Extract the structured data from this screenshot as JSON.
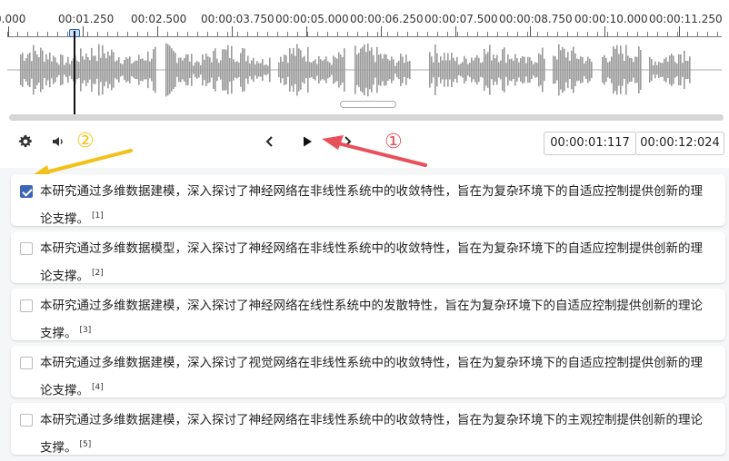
{
  "timeline": {
    "ticks": [
      "0.000",
      "00:01.250",
      "00:02.500",
      "00:00:03.750",
      "00:00:05.000",
      "00:00:06.250",
      "00:00:07.500",
      "00:00:08.750",
      "00:00:10.000",
      "00:00:11.250"
    ]
  },
  "controls": {
    "settings_icon": "gear-icon",
    "volume_icon": "speaker-icon",
    "prev_icon": "chevron-left-icon",
    "play_icon": "play-icon",
    "current_time": "00:00:01:117",
    "total_time": "00:00:12:024"
  },
  "annotations": {
    "marker_1": "①",
    "marker_1_color": "#e8505b",
    "marker_2": "②",
    "marker_2_color": "#f2c21b"
  },
  "colors": {
    "waveform": "#9a9a9a",
    "checkbox_checked": "#3b66b5"
  },
  "options": [
    {
      "text": "本研究通过多维数据建模，深入探讨了神经网络在非线性系统中的收敛特性，旨在为复杂环境下的自适应控制提供创新的理论支撑。",
      "ref": "[1]",
      "checked": true
    },
    {
      "text": "本研究通过多维数据模型，深入探讨了神经网络在非线性系统中的收敛特性，旨在为复杂环境下的自适应控制提供创新的理论支撑。",
      "ref": "[2]",
      "checked": false
    },
    {
      "text": "本研究通过多维数据建模，深入探讨了神经网络在线性系统中的发散特性，旨在为复杂环境下的自适应控制提供创新的理论支撑。",
      "ref": "[3]",
      "checked": false
    },
    {
      "text": "本研究通过多维数据建模，深入探讨了视觉网络在非线性系统中的收敛特性，旨在为复杂环境下的自适应控制提供创新的理论支撑。",
      "ref": "[4]",
      "checked": false
    },
    {
      "text": "本研究通过多维数据建模，深入探讨了神经网络在非线性系统中的收敛特性，旨在为复杂环境下的主观控制提供创新的理论支撑。",
      "ref": "[5]",
      "checked": false
    }
  ]
}
